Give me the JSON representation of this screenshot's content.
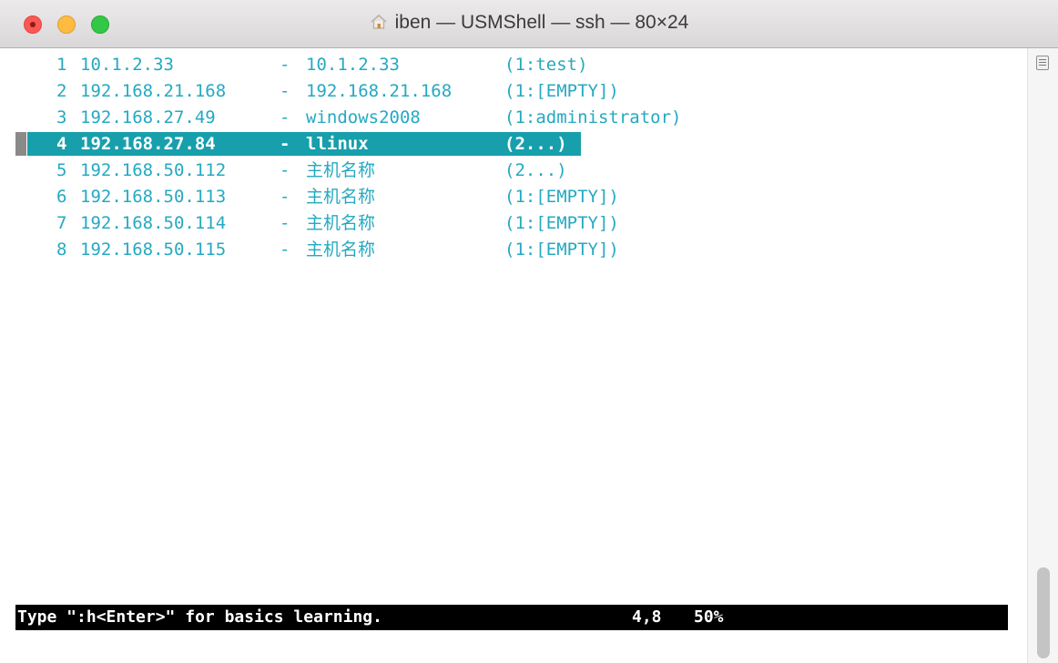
{
  "window": {
    "title": "iben — USMShell — ssh — 80×24",
    "title_icon": "home-icon"
  },
  "hosts": [
    {
      "num": "1",
      "ip": "10.1.2.33",
      "name": "10.1.2.33",
      "user": "(1:test)"
    },
    {
      "num": "2",
      "ip": "192.168.21.168",
      "name": "192.168.21.168",
      "user": "(1:[EMPTY])"
    },
    {
      "num": "3",
      "ip": "192.168.27.49",
      "name": "windows2008",
      "user": "(1:administrator)"
    },
    {
      "num": "4",
      "ip": "192.168.27.84",
      "name": "llinux",
      "user": "(2...)"
    },
    {
      "num": "5",
      "ip": "192.168.50.112",
      "name": "主机名称",
      "user": "(2...)"
    },
    {
      "num": "6",
      "ip": "192.168.50.113",
      "name": "主机名称",
      "user": "(1:[EMPTY])"
    },
    {
      "num": "7",
      "ip": "192.168.50.114",
      "name": "主机名称",
      "user": "(1:[EMPTY])"
    },
    {
      "num": "8",
      "ip": "192.168.50.115",
      "name": "主机名称",
      "user": "(1:[EMPTY])"
    }
  ],
  "separator": "-",
  "selected_index": 3,
  "status": {
    "message": "Type \":h<Enter>\" for basics learning.",
    "position": "4,8",
    "percent": "50%"
  },
  "colors": {
    "text": "#25a9c1",
    "selection": "#179fac",
    "status_bg": "#000000"
  }
}
